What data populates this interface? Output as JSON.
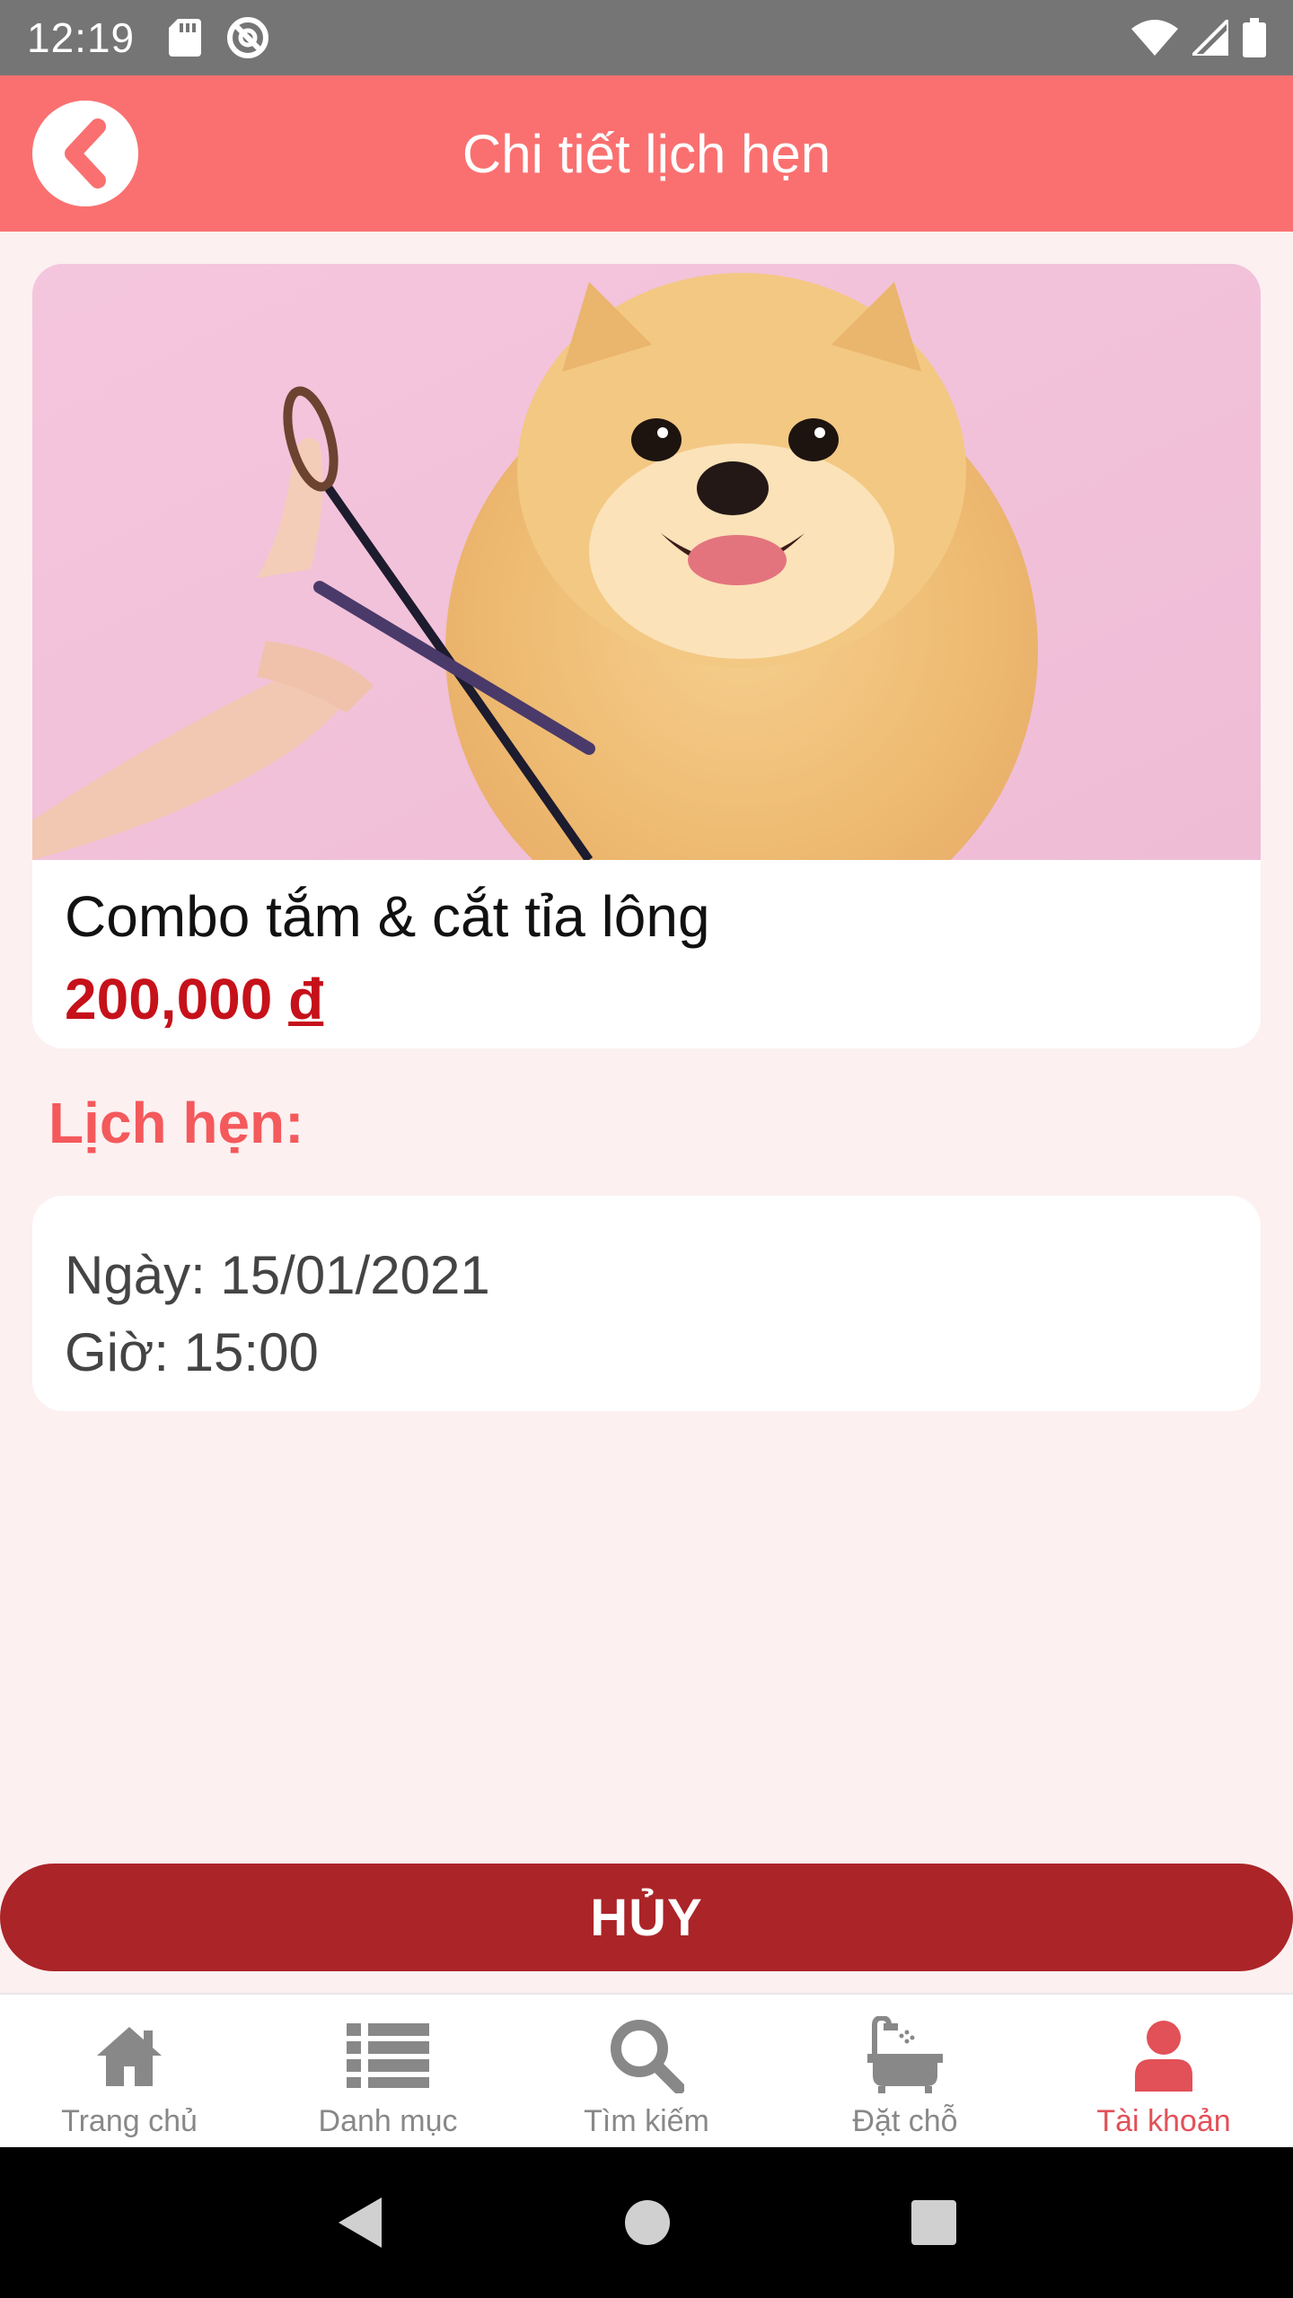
{
  "status_bar": {
    "time": "12:19",
    "left_icons": [
      "sd-card-icon",
      "blocked-icon"
    ],
    "right_icons": [
      "wifi-icon",
      "signal-icon",
      "battery-icon"
    ]
  },
  "app_bar": {
    "title": "Chi tiết lịch hẹn",
    "back_icon": "chevron-left-icon",
    "color": "#fa7070"
  },
  "service": {
    "image_alt": "pomeranian-grooming-photo",
    "name": "Combo tắm & cắt tỉa lông",
    "price_amount": "200,000",
    "price_currency": "đ",
    "price_color": "#c6111a"
  },
  "appointment": {
    "section_title": "Lịch hẹn:",
    "date_text": "Ngày: 15/01/2021",
    "time_text": "Giờ: 15:00"
  },
  "actions": {
    "cancel_label": "HỦY",
    "cancel_color": "#ab2428"
  },
  "bottom_nav": {
    "items": [
      {
        "label": "Trang chủ",
        "icon": "home-icon",
        "active": false
      },
      {
        "label": "Danh mục",
        "icon": "list-icon",
        "active": false
      },
      {
        "label": "Tìm kiếm",
        "icon": "search-icon",
        "active": false
      },
      {
        "label": "Đặt chỗ",
        "icon": "bathtub-icon",
        "active": false
      },
      {
        "label": "Tài khoản",
        "icon": "user-icon",
        "active": true
      }
    ],
    "active_color": "#e25058"
  },
  "system_nav": {
    "icons": [
      "back-triangle-icon",
      "home-circle-icon",
      "recents-square-icon"
    ]
  }
}
